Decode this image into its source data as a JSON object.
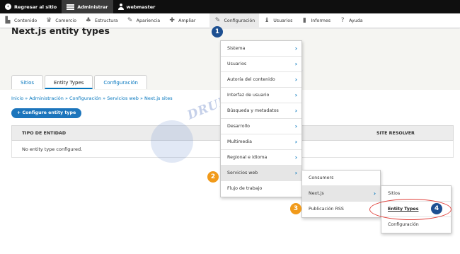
{
  "toolbar": {
    "back_label": "Regresar al sitio",
    "admin_label": "Administrar",
    "user_label": "webmaster"
  },
  "tray": {
    "items": [
      {
        "label": "Contenido",
        "icon": "file-icon"
      },
      {
        "label": "Comercio",
        "icon": "commerce-icon"
      },
      {
        "label": "Estructura",
        "icon": "structure-icon"
      },
      {
        "label": "Apariencia",
        "icon": "wrench-icon"
      },
      {
        "label": "Ampliar",
        "icon": "puzzle-icon"
      },
      {
        "label": "Configuración",
        "icon": "wrench-icon"
      },
      {
        "label": "Usuarios",
        "icon": "people-icon"
      },
      {
        "label": "Informes",
        "icon": "bars-icon"
      },
      {
        "label": "Ayuda",
        "icon": "help-icon"
      }
    ]
  },
  "page": {
    "title": "Next.js entity types",
    "tabs": [
      "Sitios",
      "Entity Types",
      "Configuración"
    ],
    "breadcrumb": "Inicio » Administración » Configuración » Servicios web » Next.js sites",
    "configure_button": "+ Configure entity type",
    "table": {
      "col_entity": "TIPO DE ENTIDAD",
      "col_resolver": "SITE RESOLVER",
      "empty": "No entity type configured."
    }
  },
  "watermark": "DRUPAL ADICTO",
  "menus": {
    "level1": [
      "Sistema",
      "Usuarios",
      "Autoría del contenido",
      "Interfaz de usuario",
      "Búsqueda y metadatos",
      "Desarrollo",
      "Multimedia",
      "Regional e idioma",
      "Servicios web",
      "Flujo de trabajo"
    ],
    "level2": [
      "Consumers",
      "Next.js",
      "Publicación RSS"
    ],
    "level3": [
      "Sitios",
      "Entity Types",
      "Configuración"
    ]
  },
  "markers": [
    "1",
    "2",
    "3",
    "4"
  ],
  "colors": {
    "accent": "#0074bd",
    "marker_blue": "#1d4f91",
    "marker_orange": "#f19a1a",
    "highlight_ring": "#e0413b"
  }
}
